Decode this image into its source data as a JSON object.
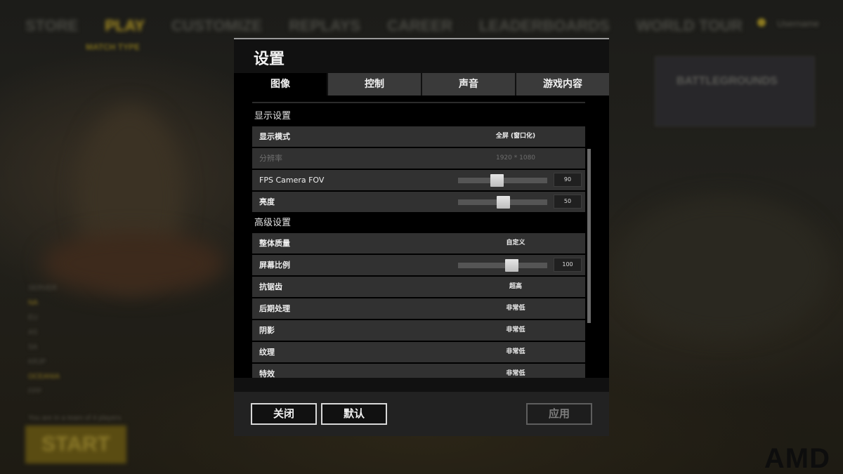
{
  "background": {
    "nav": [
      "STORE",
      "PLAY",
      "CUSTOMIZE",
      "REPLAYS",
      "CAREER",
      "LEADERBOARDS",
      "WORLD TOUR"
    ],
    "active_nav": "PLAY",
    "sub_label": "MATCH TYPE",
    "user_name": "Username",
    "ad_text": "BATTLEGROUNDS",
    "side_items": [
      "SERVER",
      "NA",
      "EU",
      "AS",
      "SA",
      "KRJP",
      "OCEANIA",
      "FPP",
      "SQUAD"
    ],
    "start_note": "You are in a team of 4 players",
    "start_label": "START",
    "watermark": "AMD"
  },
  "dialog": {
    "title": "设置",
    "tabs": [
      {
        "label": "图像",
        "active": true
      },
      {
        "label": "控制",
        "active": false
      },
      {
        "label": "声音",
        "active": false
      },
      {
        "label": "游戏内容",
        "active": false
      }
    ],
    "sections": {
      "display": "显示设置",
      "advanced": "高级设置"
    },
    "rows": {
      "display_mode": {
        "label": "显示模式",
        "value": "全屏 (窗口化)"
      },
      "resolution": {
        "label": "分辨率",
        "value": "1920 * 1080"
      },
      "fov": {
        "label": "FPS Camera FOV",
        "value": "90",
        "fraction": 0.43
      },
      "brightness": {
        "label": "亮度",
        "value": "50",
        "fraction": 0.5
      },
      "quality": {
        "label": "整体质量",
        "value": "自定义"
      },
      "screen_scale": {
        "label": "屏幕比例",
        "value": "100",
        "fraction": 0.6
      },
      "antialiasing": {
        "label": "抗锯齿",
        "value": "超高"
      },
      "post_processing": {
        "label": "后期处理",
        "value": "非常低"
      },
      "shadows": {
        "label": "阴影",
        "value": "非常低"
      },
      "textures": {
        "label": "纹理",
        "value": "非常低"
      },
      "effects": {
        "label": "特效",
        "value": "非常低"
      }
    },
    "buttons": {
      "close": "关闭",
      "default": "默认",
      "apply": "应用"
    }
  },
  "colors": {
    "panel": "#111111",
    "row": "#313131",
    "tab": "#3a3a3a",
    "accent_bg": "#a88f22"
  }
}
